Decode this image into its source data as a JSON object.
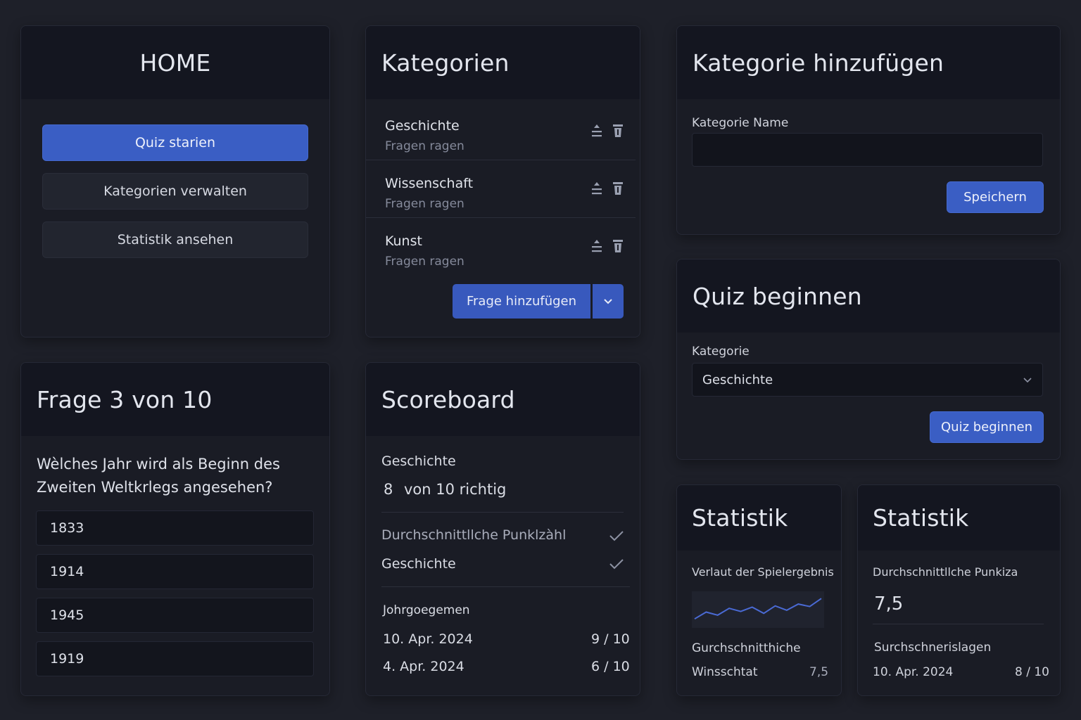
{
  "home": {
    "title": "HOME",
    "buttons": [
      "Quiz starien",
      "Kategorien verwalten",
      "Statistik ansehen"
    ],
    "accent": "#3a5ec4"
  },
  "categories": {
    "title": "Kategorien",
    "items": [
      {
        "name": "Geschichte",
        "sub": "Fragen ragen"
      },
      {
        "name": "Wissenschaft",
        "sub": "Fragen ragen"
      },
      {
        "name": "Kunst",
        "sub": "Fragen ragen"
      }
    ],
    "add_question_label": "Frage hinzufügen"
  },
  "add_category": {
    "title": "Kategorie hinzufügen",
    "name_label": "Kategorie  Name",
    "name_value": "",
    "save_label": "Speichern"
  },
  "quiz_start": {
    "title": "Quiz beginnen",
    "category_label": "Kategorie",
    "category_value": "Geschichte",
    "start_label": "Quiz beginnen"
  },
  "question": {
    "title": "Frage 3 von 10",
    "text": "Wèlches Jahr wird als Beginn des Zweiten Weltkrlegs angesehen?",
    "answers": [
      "1833",
      "1914",
      "1945",
      "1919"
    ]
  },
  "scoreboard": {
    "title": "Scoreboard",
    "category": "Geschichte",
    "score_num": "8",
    "score_text": "von 10 richtig",
    "avg_label": "Durchschnittllche Punklzàhl",
    "category2": "Geschichte",
    "history_label": "Johrgoegemen",
    "history": [
      {
        "date": "10. Apr. 2024",
        "score": "9 / 10"
      },
      {
        "date": "4. Apr. 2024",
        "score": "6 / 10"
      }
    ]
  },
  "stat1": {
    "title": "Statistik",
    "chart_label": "Verlaut der Spielergebnis",
    "avg_label": "Gurchschnitthiche",
    "row_label": "Winsschtat",
    "row_value": "7,5",
    "sparkline": [
      2.0,
      4.2,
      3.2,
      5.4,
      4.4,
      5.8,
      3.8,
      6.2,
      4.8,
      6.8,
      6.0,
      8.6
    ]
  },
  "stat2": {
    "title": "Statistik",
    "avg_label": "Durchschnittllche Punkiza",
    "avg_value": "7,5",
    "recent_label": "Surchschnerislagen",
    "recent_date": "10. Apr. 2024",
    "recent_score": "8 / 10"
  }
}
